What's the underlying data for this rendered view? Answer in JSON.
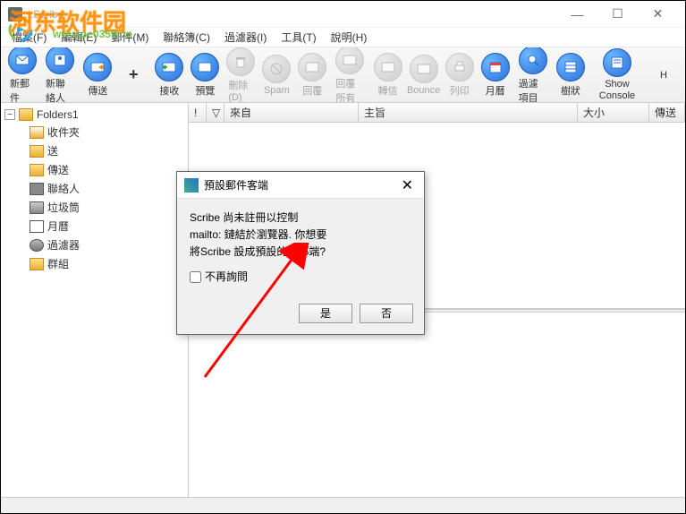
{
  "window": {
    "title": "i.Scribe",
    "min": "—",
    "max": "☐",
    "close": "✕"
  },
  "menu": {
    "file": "檔案(F)",
    "edit": "編輯(E)",
    "mail": "郵件(M)",
    "contacts": "聯絡簿(C)",
    "filter": "過濾器(I)",
    "tools": "工具(T)",
    "help": "說明(H)"
  },
  "toolbar": {
    "newmail": "新郵件",
    "newcontact": "新聯絡人",
    "send": "傳送",
    "plus": "+",
    "receive": "接收",
    "preview": "預覽",
    "delete": "刪除(D)",
    "spam": "Spam",
    "reply": "回覆",
    "replyall": "回覆所有",
    "forward": "轉信",
    "bounce": "Bounce",
    "print": "列印",
    "calendar": "月曆",
    "filteritems": "過濾項目",
    "tree": "樹狀",
    "console": "Show Console",
    "h": "H"
  },
  "tree": {
    "root": "Folders1",
    "inbox": "收件夾",
    "sent": "送",
    "outbox": "傳送",
    "contacts": "聯絡人",
    "trash": "垃圾筒",
    "calendar": "月曆",
    "filter": "過濾器",
    "group": "群組"
  },
  "columns": {
    "flag": "",
    "attach": "",
    "from": "來自",
    "subject": "主旨",
    "size": "大小",
    "sent": "傳送"
  },
  "dialog": {
    "title": "預設郵件客端",
    "line1": "Scribe 尚未註冊以控制",
    "line2": "mailto: 鏈結於瀏覽器. 你想要",
    "line3": "將Scribe 設成預設的電郵端?",
    "checkbox": "不再詢問",
    "yes": "是",
    "no": "否",
    "close": "✕"
  },
  "watermark": {
    "main": "河东软件园",
    "sub": "www.pc0359.cn"
  }
}
